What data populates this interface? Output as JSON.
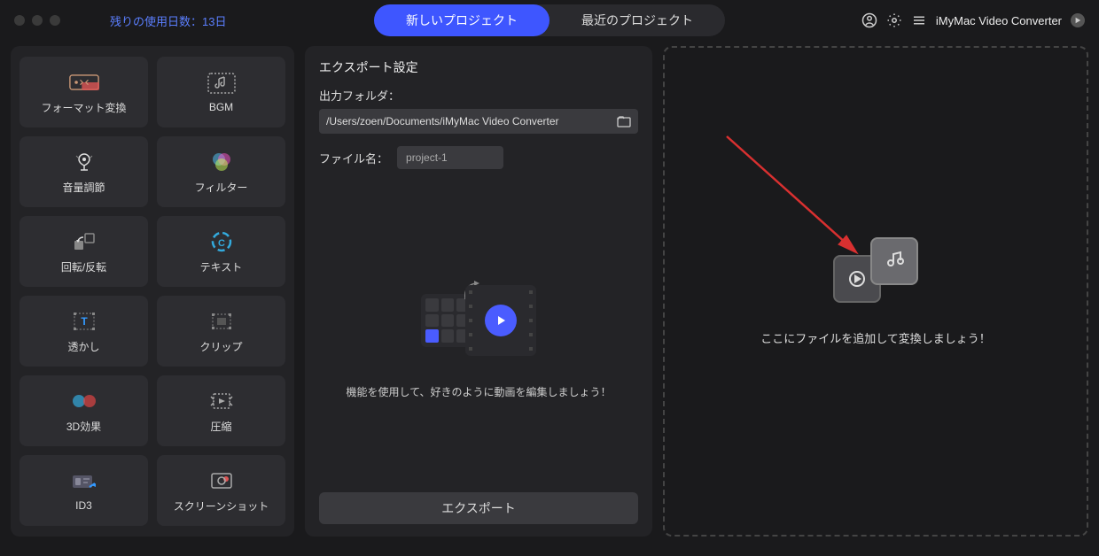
{
  "header": {
    "trial_text": "残りの使用日数：13日",
    "tab_new": "新しいプロジェクト",
    "tab_recent": "最近のプロジェクト",
    "app_name": "iMyMac Video Converter"
  },
  "tools": [
    {
      "id": "format",
      "label": "フォーマット変換"
    },
    {
      "id": "bgm",
      "label": "BGM"
    },
    {
      "id": "volume",
      "label": "音量調節"
    },
    {
      "id": "filter",
      "label": "フィルター"
    },
    {
      "id": "rotate",
      "label": "回転/反転"
    },
    {
      "id": "text",
      "label": "テキスト"
    },
    {
      "id": "watermark",
      "label": "透かし"
    },
    {
      "id": "clip",
      "label": "クリップ"
    },
    {
      "id": "3d",
      "label": "3D効果"
    },
    {
      "id": "compress",
      "label": "圧縮"
    },
    {
      "id": "id3",
      "label": "ID3"
    },
    {
      "id": "screenshot",
      "label": "スクリーンショット"
    }
  ],
  "export": {
    "title": "エクスポート設定",
    "folder_label": "出力フォルダ：",
    "folder_path": "/Users/zoen/Documents/iMyMac Video Converter",
    "filename_label": "ファイル名：",
    "filename_value": "project-1",
    "hint": "機能を使用して、好きのように動画を編集しましょう！",
    "button": "エクスポート"
  },
  "drop": {
    "text": "ここにファイルを追加して変換しましょう！"
  },
  "colors": {
    "accent": "#3e56ff",
    "arrow": "#d93030"
  }
}
